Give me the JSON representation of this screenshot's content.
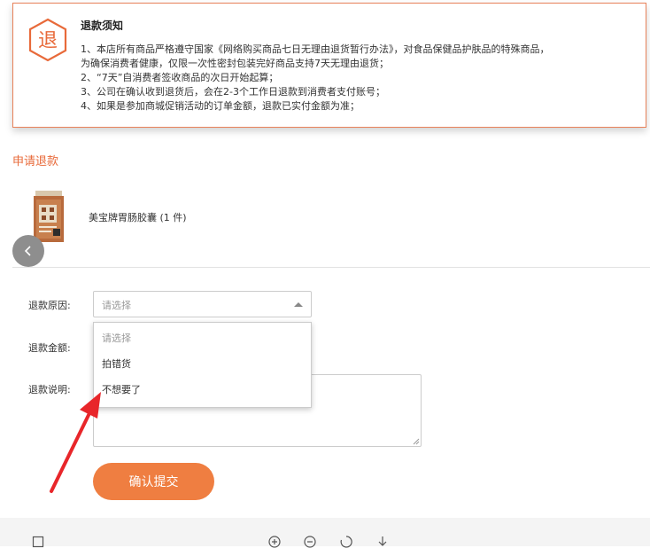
{
  "notice": {
    "icon_char": "退",
    "title": "退款须知",
    "lines": [
      "1、本店所有商品严格遵守国家《网络购买商品七日无理由退货暂行办法》，对食品保健品护肤品的特殊商品，",
      "为确保消费者健康，仅限一次性密封包装完好商品支持7天无理由退货；",
      "2、“7天”自消费者签收商品的次日开始起算；",
      "3、公司在确认收到退货后，会在2-3个工作日退款到消费者支付账号；",
      "4、如果是参加商城促销活动的订单金额，退款已实付金额为准；"
    ]
  },
  "apply": {
    "title": "申请退款",
    "product_name": "美宝牌胃肠胶囊 (1 件)"
  },
  "form": {
    "reason_label": "退款原因:",
    "reason_value": "请选择",
    "amount_label": "退款金额:",
    "note_label": "退款说明:",
    "reason_options": [
      "请选择",
      "拍错货",
      "不想要了"
    ],
    "submit_label": "确认提交"
  },
  "colors": {
    "accent": "#e86a3a",
    "button": "#ef7e41",
    "annotation_arrow": "#e8262a"
  },
  "icons": [
    "back-icon",
    "page-icon",
    "zoom-in-icon",
    "zoom-out-icon",
    "rotate-icon",
    "download-icon"
  ]
}
